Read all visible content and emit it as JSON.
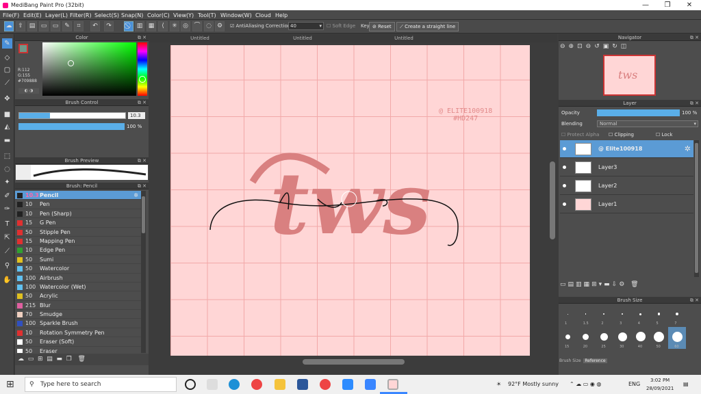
{
  "window": {
    "title": "MediBang Paint Pro (32bit)",
    "controls": [
      "—",
      "❐",
      "✕"
    ]
  },
  "menu": [
    "File(F)",
    "Edit(E)",
    "Layer(L)",
    "Filter(R)",
    "Select(S)",
    "Snap(N)",
    "Color(C)",
    "View(Y)",
    "Tool(T)",
    "Window(W)",
    "Cloud",
    "Help"
  ],
  "toolbar": {
    "antialias_label": "AntiAliasing",
    "correction_label": "Correction",
    "correction_value": "40",
    "softedge_label": "Soft Edge",
    "key_label": "Key",
    "reset_label": "Reset",
    "straight_label": "Create a straight line"
  },
  "color_panel": {
    "title": "Color",
    "r": "R:112",
    "g": "G:155",
    "hex": "#709888",
    "fg": "#709888"
  },
  "brush_control": {
    "title": "Brush Control",
    "size_value": "10.3",
    "opacity_value": "100 %",
    "size_fraction": 0.29,
    "opacity_fraction": 1.0
  },
  "brush_preview": {
    "title": "Brush Preview"
  },
  "brush_panel": {
    "title": "Brush: Pencil",
    "items": [
      {
        "size": "10.3",
        "name": "Pencil",
        "color": "#222222"
      },
      {
        "size": "10",
        "name": "Pen",
        "color": "#222222"
      },
      {
        "size": "10",
        "name": "Pen (Sharp)",
        "color": "#222222"
      },
      {
        "size": "15",
        "name": "G Pen",
        "color": "#e03030"
      },
      {
        "size": "50",
        "name": "Stipple Pen",
        "color": "#e03030"
      },
      {
        "size": "15",
        "name": "Mapping Pen",
        "color": "#e03030"
      },
      {
        "size": "10",
        "name": "Edge Pen",
        "color": "#30a030"
      },
      {
        "size": "50",
        "name": "Sumi",
        "color": "#e0c020"
      },
      {
        "size": "50",
        "name": "Watercolor",
        "color": "#60c0f0"
      },
      {
        "size": "100",
        "name": "Airbrush",
        "color": "#60c0f0"
      },
      {
        "size": "100",
        "name": "Watercolor (Wet)",
        "color": "#60c0f0"
      },
      {
        "size": "50",
        "name": "Acrylic",
        "color": "#e0c020"
      },
      {
        "size": "215",
        "name": "Blur",
        "color": "#e060a0"
      },
      {
        "size": "70",
        "name": "Smudge",
        "color": "#f0d0c0"
      },
      {
        "size": "100",
        "name": "Sparkle Brush",
        "color": "#3050c0"
      },
      {
        "size": "10",
        "name": "Rotation Symmetry Pen",
        "color": "#e03030"
      },
      {
        "size": "50",
        "name": "Eraser (Soft)",
        "color": "#ffffff"
      },
      {
        "size": "50",
        "name": "Eraser",
        "color": "#ffffff"
      }
    ]
  },
  "tabs": [
    "Untitled",
    "Untitled",
    "Untitled"
  ],
  "canvas": {
    "watermark_line1": "@ ELITE100918",
    "watermark_line2": "#HD247",
    "big_letters": "tws",
    "script_text": "tws",
    "paper_color": "#ffd6d6",
    "ink_color": "#d98080"
  },
  "navigator": {
    "title": "Navigator",
    "thumb_text": "tws"
  },
  "layer_panel": {
    "title": "Layer",
    "opacity_label": "Opacity",
    "opacity_value": "100 %",
    "blending_label": "Blending",
    "blending_value": "Normal",
    "protect_alpha": "Protect Alpha",
    "clipping": "Clipping",
    "lock": "Lock",
    "layers": [
      {
        "name": "@ Elite100918",
        "selected": true
      },
      {
        "name": "Layer3",
        "selected": false
      },
      {
        "name": "Layer2",
        "selected": false
      },
      {
        "name": "Layer1",
        "selected": false
      }
    ]
  },
  "brush_size": {
    "title": "Brush Size",
    "tabs": [
      "Brush Size",
      "Reference"
    ],
    "row1": [
      "1",
      "1.5",
      "2",
      "3",
      "4",
      "5",
      "7"
    ],
    "row2": [
      "15",
      "20",
      "25",
      "30",
      "40",
      "50",
      "60"
    ]
  },
  "taskbar": {
    "search_placeholder": "Type here to search",
    "weather": "92°F  Mostly sunny",
    "lang": "ENG",
    "time": "3:02 PM",
    "date": "28/09/2021"
  }
}
